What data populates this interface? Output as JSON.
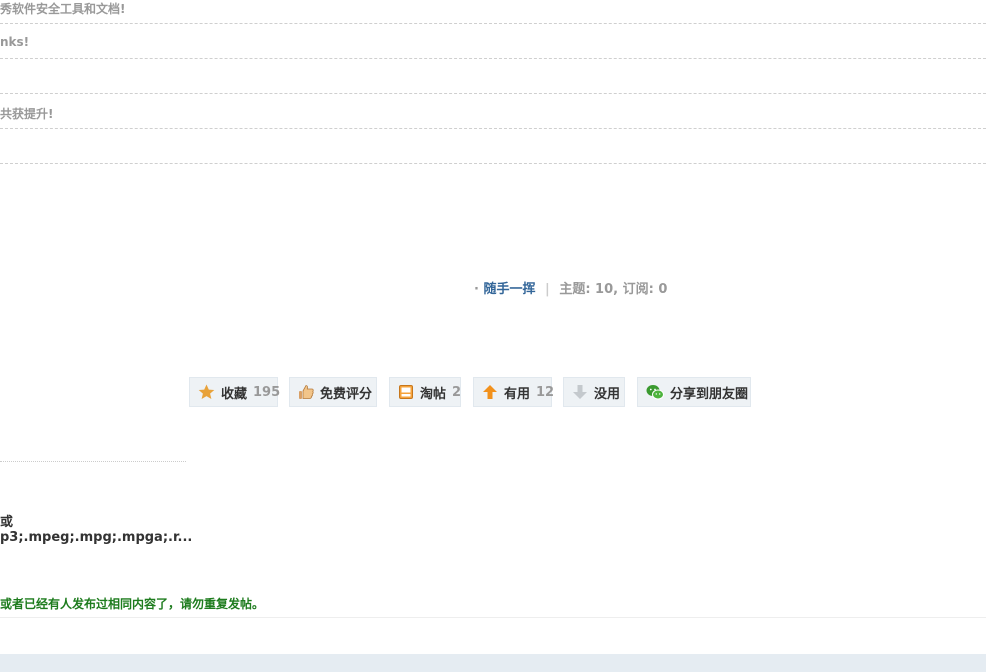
{
  "top_rows": [
    {
      "text": "秀软件安全工具和文档!"
    },
    {
      "text": "nks!"
    },
    {
      "text": ""
    },
    {
      "text": "共获提升!"
    },
    {
      "text": ""
    }
  ],
  "forum_info": {
    "bullet": "·",
    "forum_name": "随手一挥",
    "separator": "|",
    "stats": "主题: 10, 订阅: 0"
  },
  "actions": {
    "favorite": {
      "label": "收藏",
      "count": "195",
      "icon": "star-icon"
    },
    "rate": {
      "label": "免费评分",
      "icon": "thumbs-up-icon"
    },
    "collect": {
      "label": "淘帖",
      "count": "2",
      "icon": "tray-icon"
    },
    "useful": {
      "label": "有用",
      "count": "12",
      "icon": "arrow-up-icon"
    },
    "useless": {
      "label": "没用",
      "icon": "arrow-down-icon"
    },
    "share": {
      "label": "分享到朋友圈",
      "icon": "wechat-icon"
    }
  },
  "attachment": {
    "line1": "或",
    "line2": "p3;.mpeg;.mpg;.mpga;.r..."
  },
  "notice": "或者已经有人发布过相同内容了，请勿重复发帖。",
  "colors": {
    "link": "#336699",
    "notice_green": "#1e7c1e",
    "button_bg": "#eef2f5",
    "star": "#e8a23a"
  }
}
